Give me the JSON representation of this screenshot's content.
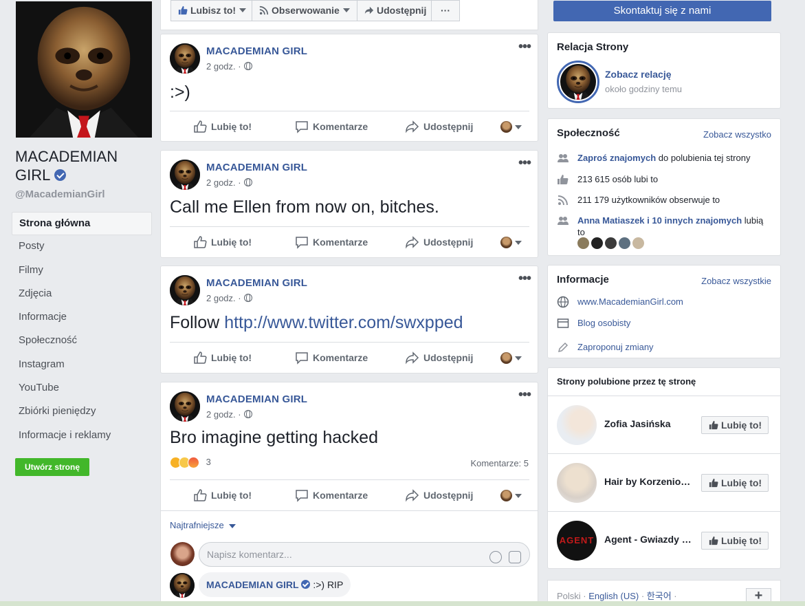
{
  "page": {
    "name": "MACADEMIAN GIRL",
    "handle": "@MacademianGirl"
  },
  "left_nav": {
    "items": [
      "Strona główna",
      "Posty",
      "Filmy",
      "Zdjęcia",
      "Informacje",
      "Społeczność",
      "Instagram",
      "YouTube",
      "Zbiórki pieniędzy",
      "Informacje i reklamy"
    ],
    "create_page": "Utwórz stronę"
  },
  "actionbar": {
    "like": "Lubisz to!",
    "follow": "Obserwowanie",
    "share": "Udostępnij",
    "more": "···",
    "contact": "Skontaktuj się z nami"
  },
  "post_actions": {
    "like": "Lubię to!",
    "comment": "Komentarze",
    "share": "Udostępnij"
  },
  "posts": [
    {
      "author": "MACADEMIAN GIRL",
      "time": "2 godz. ·",
      "text": ":>)"
    },
    {
      "author": "MACADEMIAN GIRL",
      "time": "2 godz. ·",
      "text": "Call me Ellen from now on, bitches."
    },
    {
      "author": "MACADEMIAN GIRL",
      "time": "2 godz. ·",
      "text_prefix": "Follow ",
      "link": "http://www.twitter.com/swxpped"
    },
    {
      "author": "MACADEMIAN GIRL",
      "time": "2 godz. ·",
      "text": "Bro imagine getting hacked",
      "reactions_count": "3",
      "comments_count": "Komentarze: 5",
      "sort": "Najtrafniejsze",
      "comment_placeholder": "Napisz komentarz...",
      "reply": {
        "author": "MACADEMIAN GIRL",
        "text": ":>) RIP"
      }
    }
  ],
  "relation": {
    "title": "Relacja Strony",
    "link": "Zobacz relację",
    "time": "około godziny temu"
  },
  "community": {
    "title": "Społeczność",
    "see_all": "Zobacz wszystko",
    "invite_link": "Zaproś znajomych",
    "invite_rest": " do polubienia tej strony",
    "likes": "213 615 osób lubi to",
    "followers": "211 179 użytkowników obserwuje to",
    "friends_link": "Anna Matiaszek i 10 innych znajomych",
    "friends_rest": " lubią to"
  },
  "info": {
    "title": "Informacje",
    "see_all": "Zobacz wszystkie",
    "website": "www.MacademianGirl.com",
    "category": "Blog osobisty",
    "suggest": "Zaproponuj zmiany"
  },
  "liked_pages": {
    "title": "Strony polubione przez tę stronę",
    "items": [
      {
        "name": "Zofia Jasińska",
        "button": "Lubię to!"
      },
      {
        "name": "Hair by Korzeniowska",
        "button": "Lubię to!"
      },
      {
        "name": "Agent - Gwiazdy TVN",
        "button": "Lubię to!"
      }
    ],
    "avatar_text": "AGENT"
  },
  "languages": {
    "current": "Polski",
    "sep": " · ",
    "english": "English (US)",
    "korean": "한국어",
    "trail": " ·",
    "add": "+"
  },
  "colors": {
    "brand": "#4267b2",
    "link": "#385898",
    "create_green": "#42b72a"
  }
}
